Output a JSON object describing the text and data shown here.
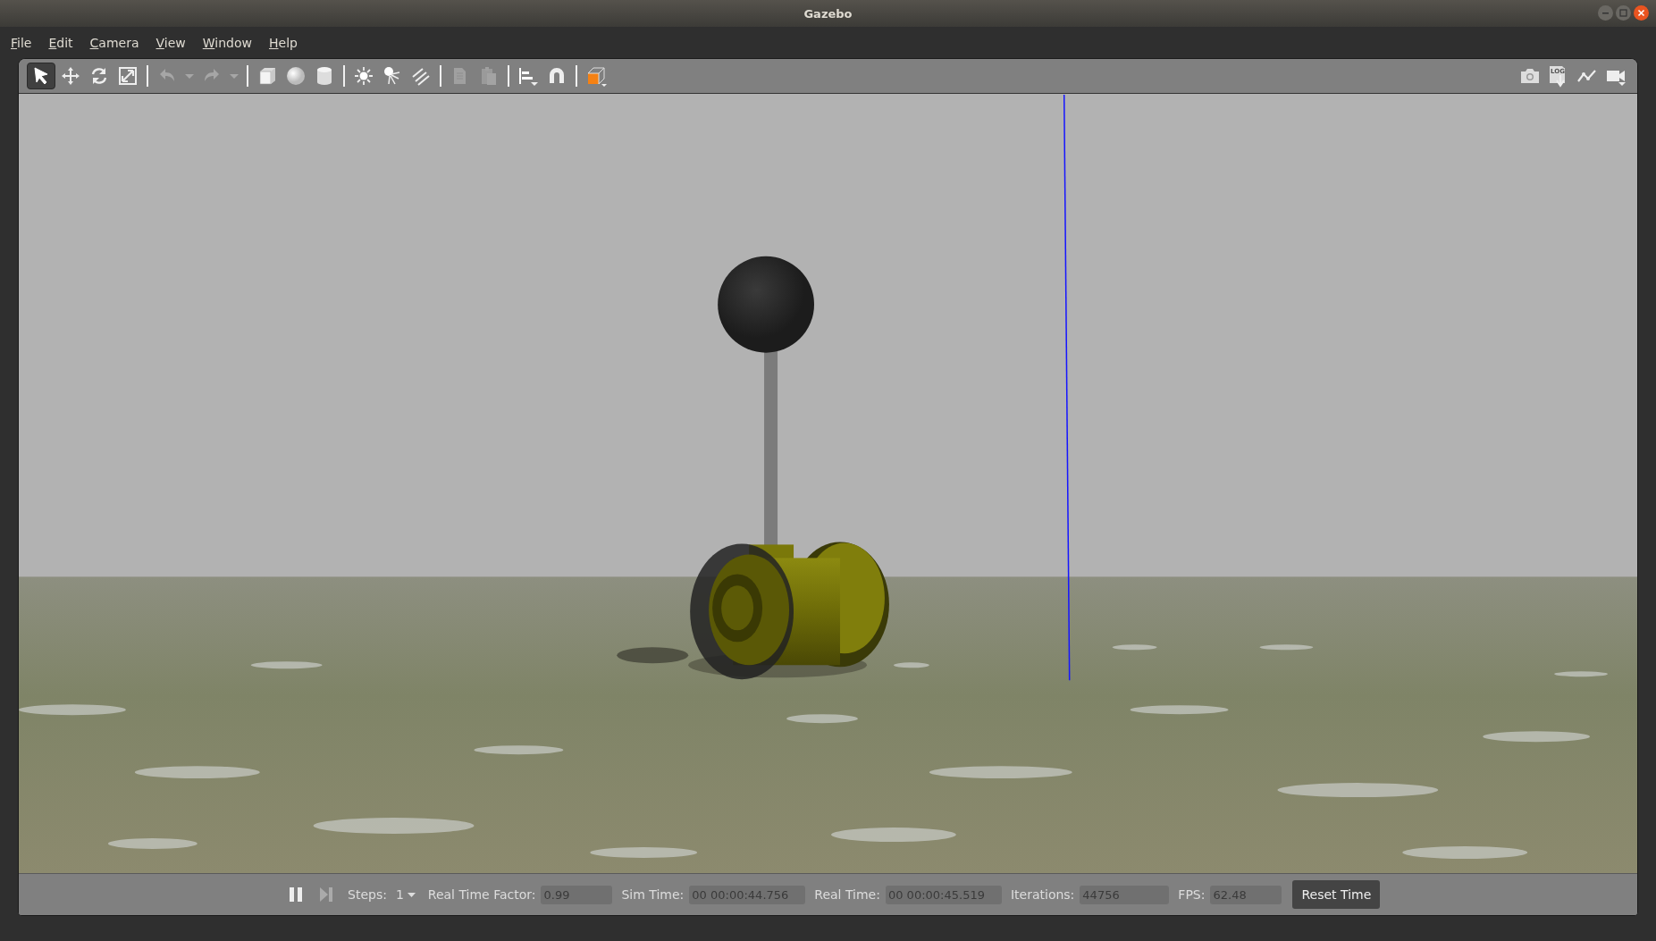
{
  "window": {
    "title": "Gazebo"
  },
  "menu": [
    "File",
    "Edit",
    "Camera",
    "View",
    "Window",
    "Help"
  ],
  "toolbar": {
    "mode_tools": [
      {
        "selected": true
      },
      {
        "selected": false
      },
      {
        "selected": false
      },
      {
        "selected": false
      }
    ],
    "edit_tools": [
      {
        "disabled": true
      },
      {
        "disabled": true
      },
      {
        "disabled": true
      },
      {
        "disabled": true
      }
    ],
    "log_label": "LOG"
  },
  "timebar": {
    "steps": {
      "label": "Steps:",
      "value": "1"
    },
    "readouts": [
      {
        "label": "Real Time Factor:",
        "value": "0.99"
      },
      {
        "label": "Sim Time:",
        "value": "00 00:00:44.756"
      },
      {
        "label": "Real Time:",
        "value": "00 00:00:45.519"
      },
      {
        "label": "Iterations:",
        "value": "44756"
      },
      {
        "label": "FPS:",
        "value": "62.48"
      }
    ],
    "reset_button": "Reset Time"
  }
}
